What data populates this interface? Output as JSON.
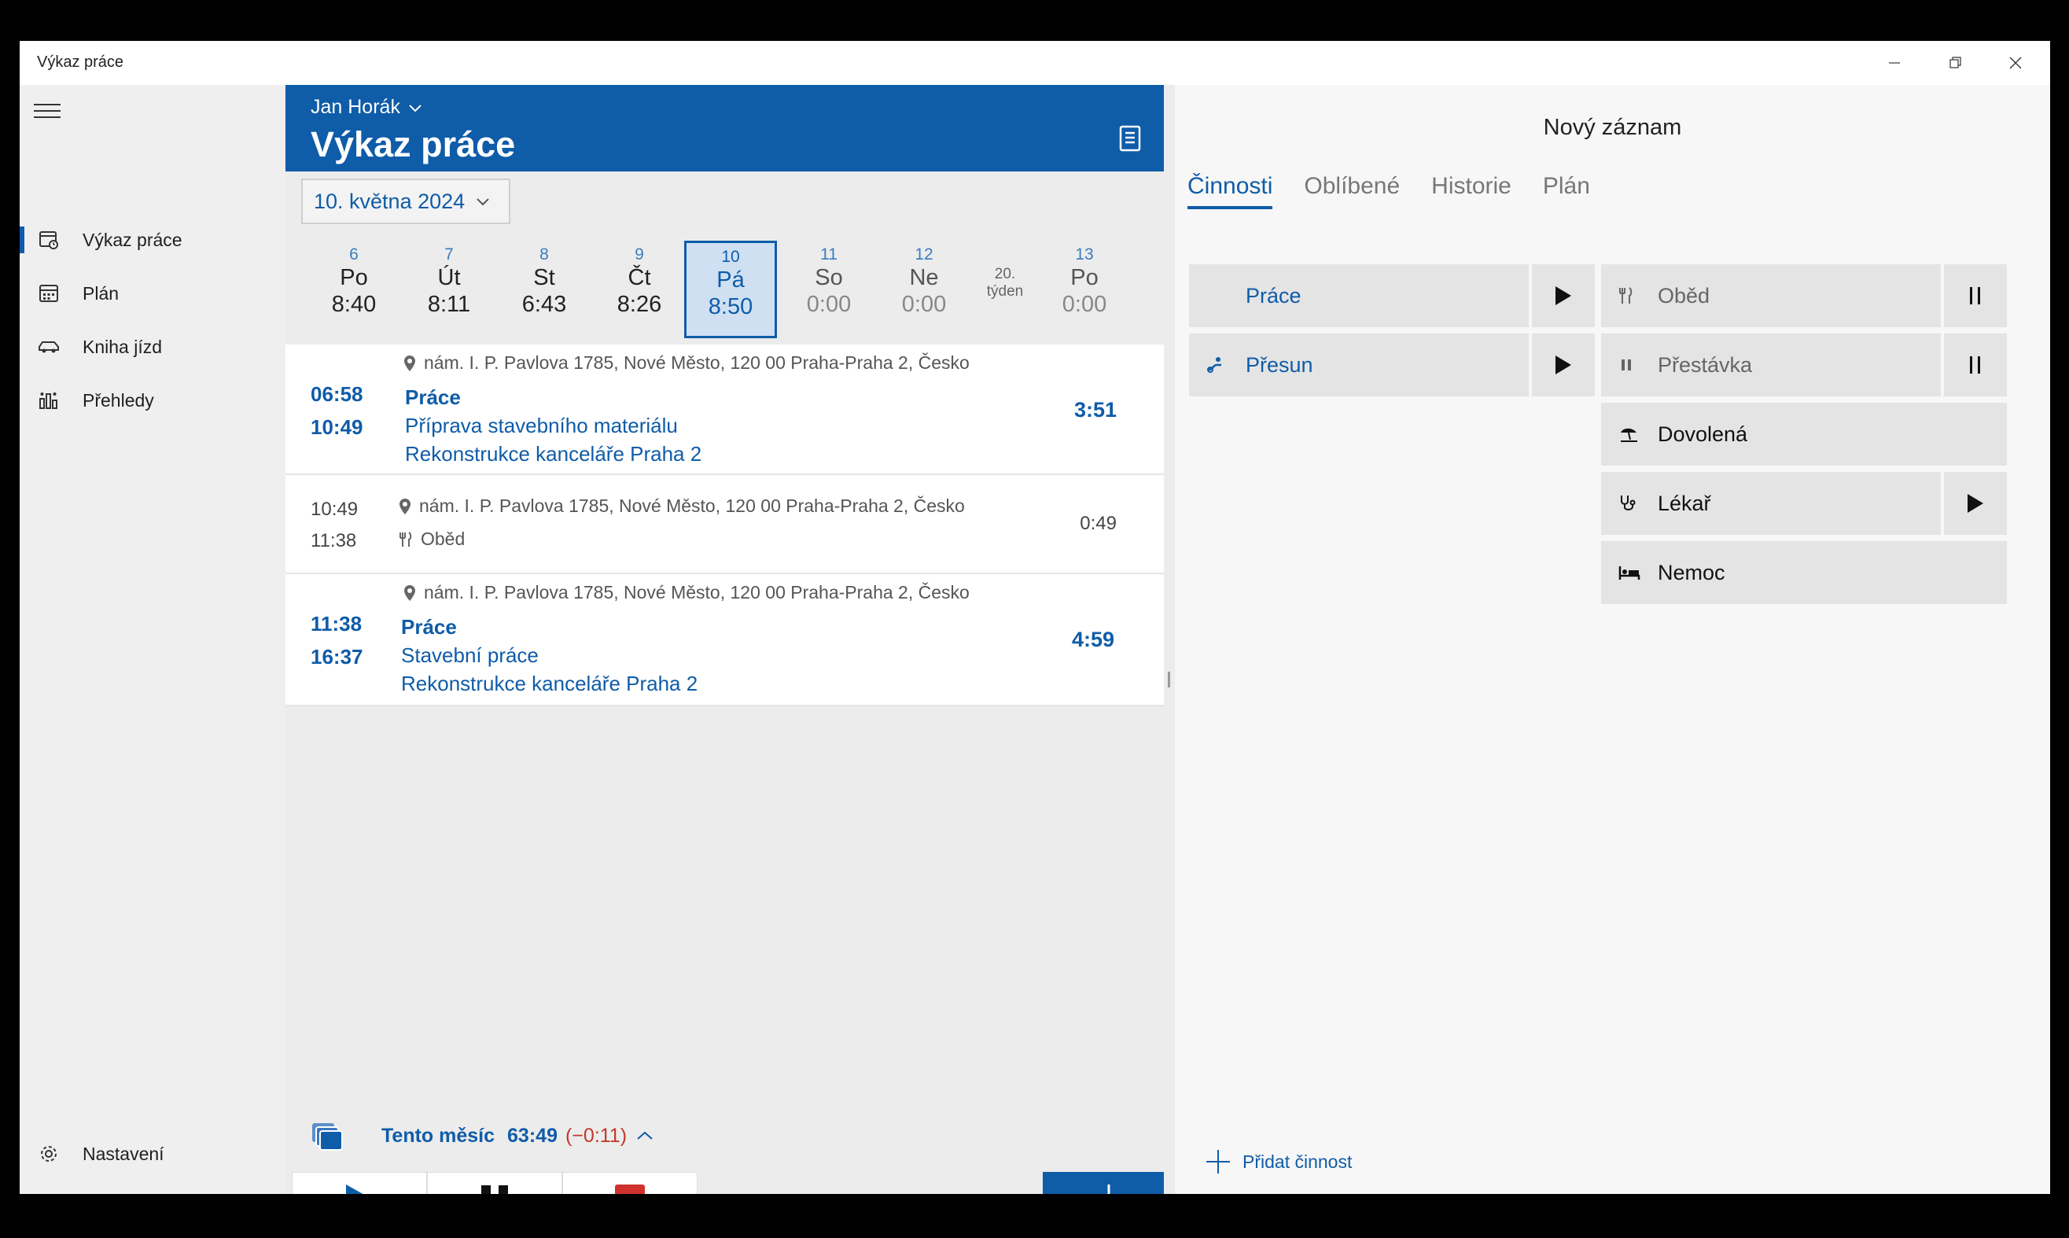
{
  "window": {
    "title": "Výkaz práce"
  },
  "sidebar": {
    "items": [
      {
        "label": "Výkaz práce",
        "icon": "timesheet-icon",
        "selected": true
      },
      {
        "label": "Plán",
        "icon": "calendar-icon"
      },
      {
        "label": "Kniha jízd",
        "icon": "car-icon"
      },
      {
        "label": "Přehledy",
        "icon": "chart-icon"
      }
    ],
    "settings_label": "Nastavení"
  },
  "header": {
    "user": "Jan Horák",
    "title": "Výkaz práce"
  },
  "date": {
    "label": "10. května 2024"
  },
  "days": [
    {
      "num": "6",
      "name": "Po",
      "hours": "8:40"
    },
    {
      "num": "7",
      "name": "Út",
      "hours": "8:11"
    },
    {
      "num": "8",
      "name": "St",
      "hours": "6:43"
    },
    {
      "num": "9",
      "name": "Čt",
      "hours": "8:26"
    },
    {
      "num": "10",
      "name": "Pá",
      "hours": "8:50",
      "selected": true
    },
    {
      "num": "11",
      "name": "So",
      "hours": "0:00"
    },
    {
      "num": "12",
      "name": "Ne",
      "hours": "0:00"
    },
    {
      "num": "13",
      "name": "Po",
      "hours": "0:00"
    }
  ],
  "week": {
    "num": "20.",
    "label": "týden"
  },
  "entries": [
    {
      "location": "nám. I. P. Pavlova 1785, Nové Město, 120 00 Praha-Praha 2, Česko",
      "start": "06:58",
      "end": "10:49",
      "activity": "Práce",
      "task": "Příprava stavebního materiálu",
      "project": "Rekonstrukce kanceláře Praha 2",
      "duration": "3:51"
    },
    {
      "location": "nám. I. P. Pavlova 1785, Nové Město, 120 00 Praha-Praha 2, Česko",
      "start": "10:49",
      "end": "11:38",
      "activity": "Oběd",
      "duration": "0:49"
    },
    {
      "location": "nám. I. P. Pavlova 1785, Nové Město, 120 00 Praha-Praha 2, Česko",
      "start": "11:38",
      "end": "16:37",
      "activity": "Práce",
      "task": "Stavební práce",
      "project": "Rekonstrukce kanceláře Praha 2",
      "duration": "4:59"
    }
  ],
  "summary": {
    "label": "Tento měsíc",
    "value": "63:49",
    "diff": "(−0:11)"
  },
  "panel": {
    "title": "Nový záznam",
    "tabs": [
      "Činnosti",
      "Oblíbené",
      "Historie",
      "Plán"
    ],
    "activities": {
      "prace": "Práce",
      "presun": "Přesun",
      "obed": "Oběd",
      "prestavka": "Přestávka",
      "dovolena": "Dovolená",
      "lekar": "Lékař",
      "nemoc": "Nemoc"
    },
    "add_label": "Přidat činnost"
  },
  "colors": {
    "accent": "#0f5ca8",
    "stop": "#d0312d",
    "diff": "#c0392b"
  }
}
